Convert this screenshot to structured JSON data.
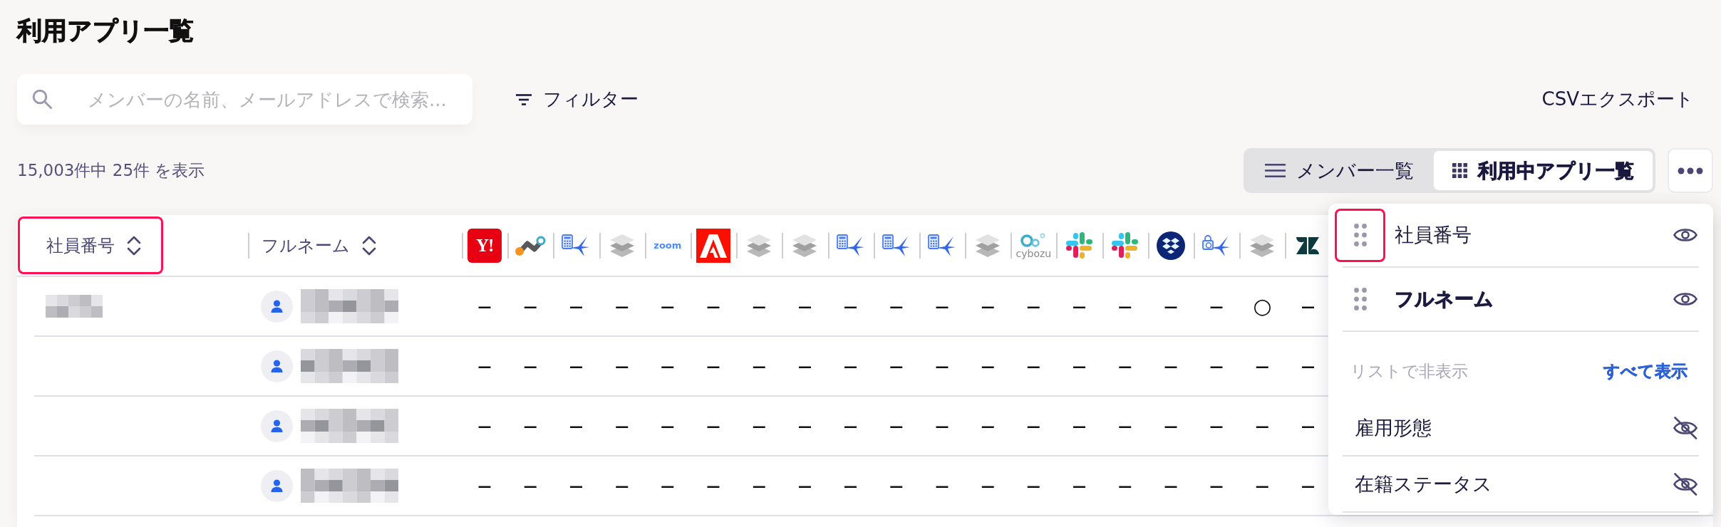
{
  "title": "利用アプリ一覧",
  "search": {
    "placeholder": "メンバーの名前、メールアドレスで検索..."
  },
  "filter_button": {
    "label": "フィルター"
  },
  "export_button": {
    "label": "CSVエクスポート"
  },
  "result_count": "15,003件中 25件 を表示",
  "view_toggle": [
    {
      "kind": "list",
      "label": "メンバー一覧",
      "selected": false
    },
    {
      "kind": "grid",
      "label": "利用中アプリ一覧",
      "selected": true
    }
  ],
  "table": {
    "columns": [
      {
        "label": "社員番号",
        "highlighted": true
      },
      {
        "label": "フルネーム",
        "highlighted": false
      }
    ],
    "app_columns": [
      {
        "kind": "text_tile",
        "logo_text": "Y!"
      },
      {
        "kind": "nodes"
      },
      {
        "kind": "calculator_bird"
      },
      {
        "kind": "layers"
      },
      {
        "kind": "wordmark",
        "logo_text": "zoom"
      },
      {
        "kind": "a_tile"
      },
      {
        "kind": "layers"
      },
      {
        "kind": "layers"
      },
      {
        "kind": "calculator_bird"
      },
      {
        "kind": "calculator_bird"
      },
      {
        "kind": "calculator_bird"
      },
      {
        "kind": "layers"
      },
      {
        "kind": "rings_wordmark",
        "logo_text": "cybozu"
      },
      {
        "kind": "hash"
      },
      {
        "kind": "hash"
      },
      {
        "kind": "diamond_disc"
      },
      {
        "kind": "lock_bird"
      },
      {
        "kind": "layers"
      },
      {
        "kind": "z_mark"
      }
    ],
    "rows": [
      {
        "id_redacted": true,
        "name_redacted": true,
        "cells": [
          {
            "kind": "none",
            "text": "—"
          },
          {
            "kind": "none",
            "text": "—"
          },
          {
            "kind": "none",
            "text": "—"
          },
          {
            "kind": "none",
            "text": "—"
          },
          {
            "kind": "none",
            "text": "—"
          },
          {
            "kind": "none",
            "text": "—"
          },
          {
            "kind": "none",
            "text": "—"
          },
          {
            "kind": "none",
            "text": "—"
          },
          {
            "kind": "none",
            "text": "—"
          },
          {
            "kind": "none",
            "text": "—"
          },
          {
            "kind": "none",
            "text": "—"
          },
          {
            "kind": "none",
            "text": "—"
          },
          {
            "kind": "none",
            "text": "—"
          },
          {
            "kind": "none",
            "text": "—"
          },
          {
            "kind": "none",
            "text": "—"
          },
          {
            "kind": "none",
            "text": "—"
          },
          {
            "kind": "none",
            "text": "—"
          },
          {
            "kind": "used",
            "text": "○"
          },
          {
            "kind": "none",
            "text": "—"
          }
        ]
      },
      {
        "id_redacted": false,
        "name_redacted": true,
        "cells": [
          {
            "kind": "none",
            "text": "—"
          },
          {
            "kind": "none",
            "text": "—"
          },
          {
            "kind": "none",
            "text": "—"
          },
          {
            "kind": "none",
            "text": "—"
          },
          {
            "kind": "none",
            "text": "—"
          },
          {
            "kind": "none",
            "text": "—"
          },
          {
            "kind": "none",
            "text": "—"
          },
          {
            "kind": "none",
            "text": "—"
          },
          {
            "kind": "none",
            "text": "—"
          },
          {
            "kind": "none",
            "text": "—"
          },
          {
            "kind": "none",
            "text": "—"
          },
          {
            "kind": "none",
            "text": "—"
          },
          {
            "kind": "none",
            "text": "—"
          },
          {
            "kind": "none",
            "text": "—"
          },
          {
            "kind": "none",
            "text": "—"
          },
          {
            "kind": "none",
            "text": "—"
          },
          {
            "kind": "none",
            "text": "—"
          },
          {
            "kind": "none",
            "text": "—"
          },
          {
            "kind": "none",
            "text": "—"
          }
        ]
      },
      {
        "id_redacted": false,
        "name_redacted": true,
        "cells": [
          {
            "kind": "none",
            "text": "—"
          },
          {
            "kind": "none",
            "text": "—"
          },
          {
            "kind": "none",
            "text": "—"
          },
          {
            "kind": "none",
            "text": "—"
          },
          {
            "kind": "none",
            "text": "—"
          },
          {
            "kind": "none",
            "text": "—"
          },
          {
            "kind": "none",
            "text": "—"
          },
          {
            "kind": "none",
            "text": "—"
          },
          {
            "kind": "none",
            "text": "—"
          },
          {
            "kind": "none",
            "text": "—"
          },
          {
            "kind": "none",
            "text": "—"
          },
          {
            "kind": "none",
            "text": "—"
          },
          {
            "kind": "none",
            "text": "—"
          },
          {
            "kind": "none",
            "text": "—"
          },
          {
            "kind": "none",
            "text": "—"
          },
          {
            "kind": "none",
            "text": "—"
          },
          {
            "kind": "none",
            "text": "—"
          },
          {
            "kind": "none",
            "text": "—"
          },
          {
            "kind": "none",
            "text": "—"
          }
        ]
      },
      {
        "id_redacted": false,
        "name_redacted": true,
        "cells": [
          {
            "kind": "none",
            "text": "—"
          },
          {
            "kind": "none",
            "text": "—"
          },
          {
            "kind": "none",
            "text": "—"
          },
          {
            "kind": "none",
            "text": "—"
          },
          {
            "kind": "none",
            "text": "—"
          },
          {
            "kind": "none",
            "text": "—"
          },
          {
            "kind": "none",
            "text": "—"
          },
          {
            "kind": "none",
            "text": "—"
          },
          {
            "kind": "none",
            "text": "—"
          },
          {
            "kind": "none",
            "text": "—"
          },
          {
            "kind": "none",
            "text": "—"
          },
          {
            "kind": "none",
            "text": "—"
          },
          {
            "kind": "none",
            "text": "—"
          },
          {
            "kind": "none",
            "text": "—"
          },
          {
            "kind": "none",
            "text": "—"
          },
          {
            "kind": "none",
            "text": "—"
          },
          {
            "kind": "none",
            "text": "—"
          },
          {
            "kind": "none",
            "text": "—"
          },
          {
            "kind": "none",
            "text": "—"
          }
        ]
      }
    ]
  },
  "column_panel": {
    "shown": [
      {
        "label": "社員番号",
        "highlighted": true,
        "selected": false,
        "visible": true
      },
      {
        "label": "フルネーム",
        "highlighted": false,
        "selected": true,
        "visible": true
      }
    ],
    "hidden_heading": "リストで非表示",
    "show_all_link": "すべて表示",
    "hidden": [
      {
        "label": "雇用形態",
        "visible": false
      },
      {
        "label": "在籍ステータス",
        "visible": false
      }
    ]
  }
}
